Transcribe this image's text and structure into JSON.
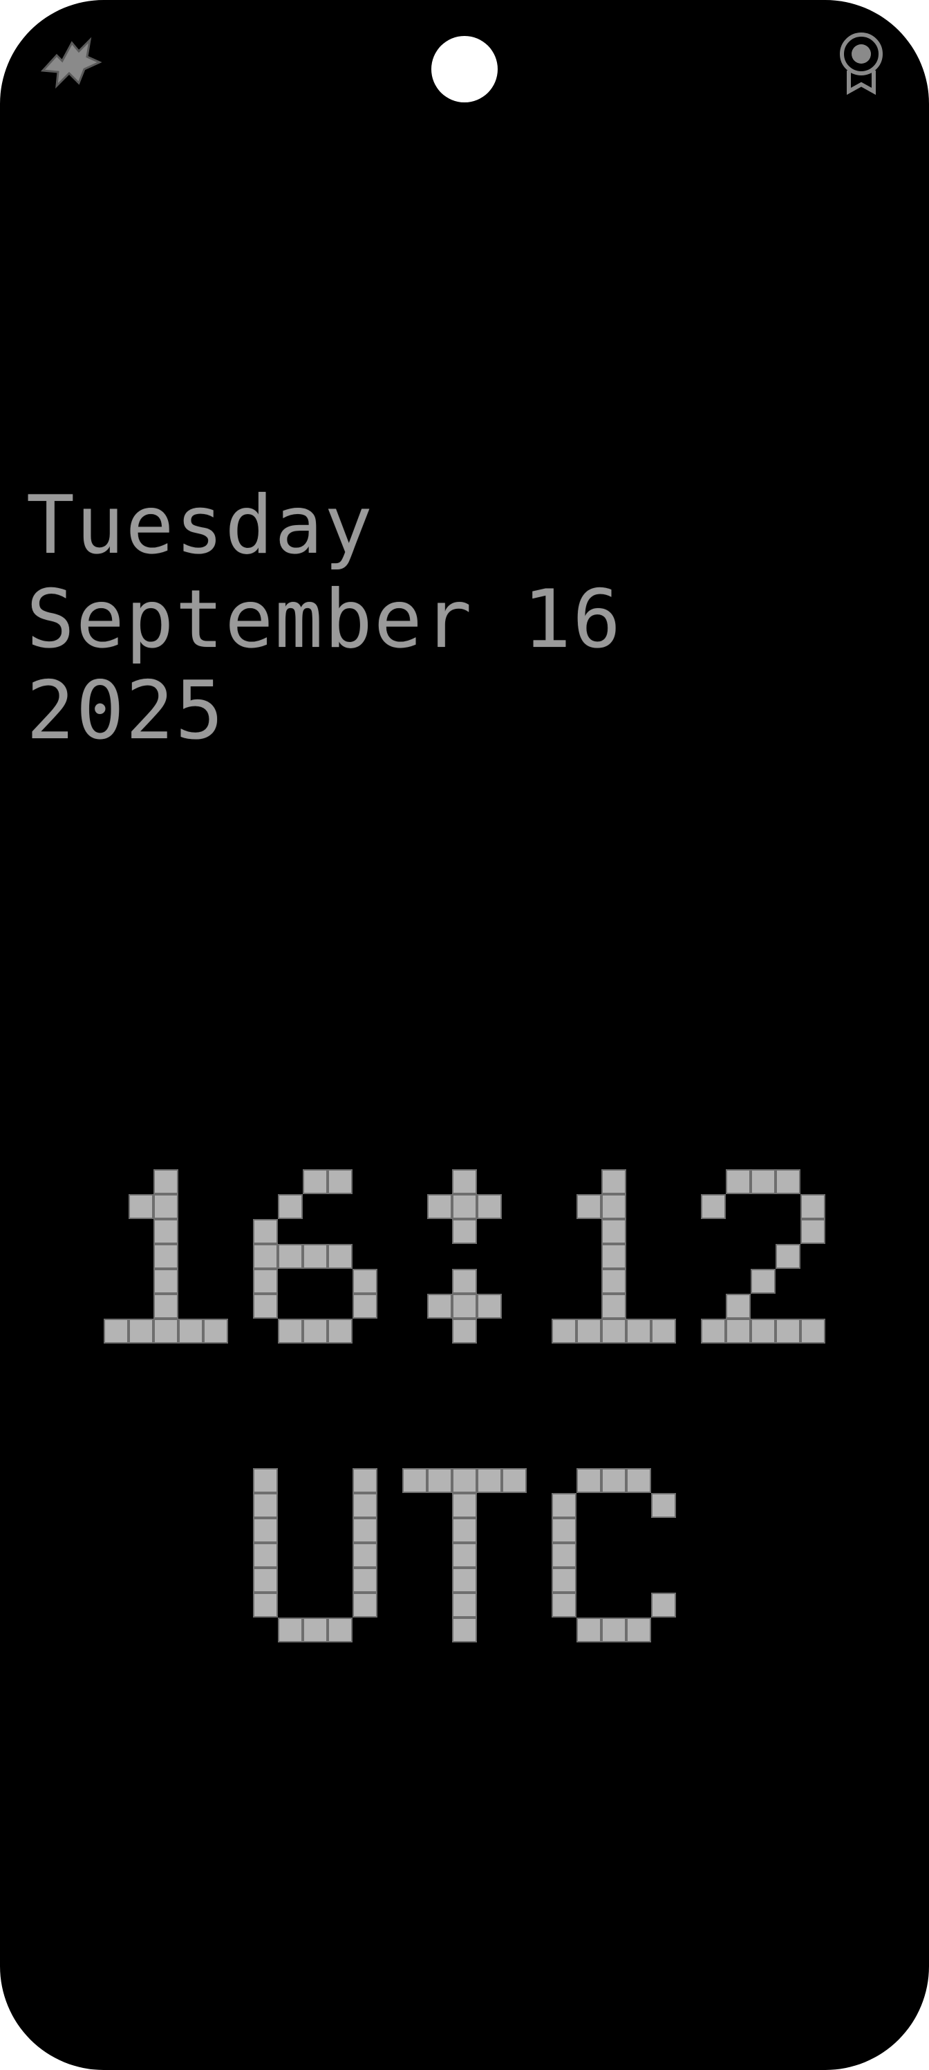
{
  "status_bar": {
    "left_icon": "dragon-logo-icon",
    "center_icon": "front-camera-icon",
    "right_icon": "award-ribbon-icon"
  },
  "date": {
    "weekday": "Tuesday",
    "month_day": "September 16",
    "year": "2025"
  },
  "clock": {
    "time": "16:12",
    "timezone": "UTC"
  },
  "colors": {
    "background": "#000000",
    "pixel": "#b4b4b4",
    "pixel_outline": "#6e6e6e"
  }
}
